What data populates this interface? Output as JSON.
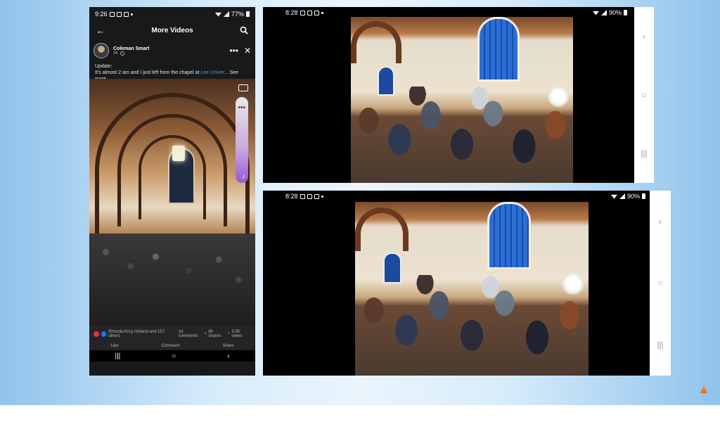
{
  "phone": {
    "status": {
      "time": "9:26",
      "battery": "77%"
    },
    "header": {
      "title": "More Videos"
    },
    "post": {
      "author": "Coleman Smart",
      "time": "3h",
      "text_prefix": "Update:",
      "text_body": "It's almost 2 am and I just left from the chapel at ",
      "text_link": "Lee Univer...",
      "see_more": "See more"
    },
    "reactions": {
      "names": "Rhonda King Holland and 157 others",
      "comments": "14 comments",
      "shares": "84 shares",
      "views": "3.5K views"
    },
    "actions": {
      "like": "Like",
      "comment": "Comment",
      "share": "Share"
    }
  },
  "shot_top": {
    "time": "8:28",
    "battery": "90%"
  },
  "shot_bottom": {
    "time": "8:28",
    "battery": "90%"
  },
  "icons": {
    "back": "back-arrow-icon",
    "search": "search-icon",
    "more": "more-icon",
    "close": "close-icon"
  }
}
